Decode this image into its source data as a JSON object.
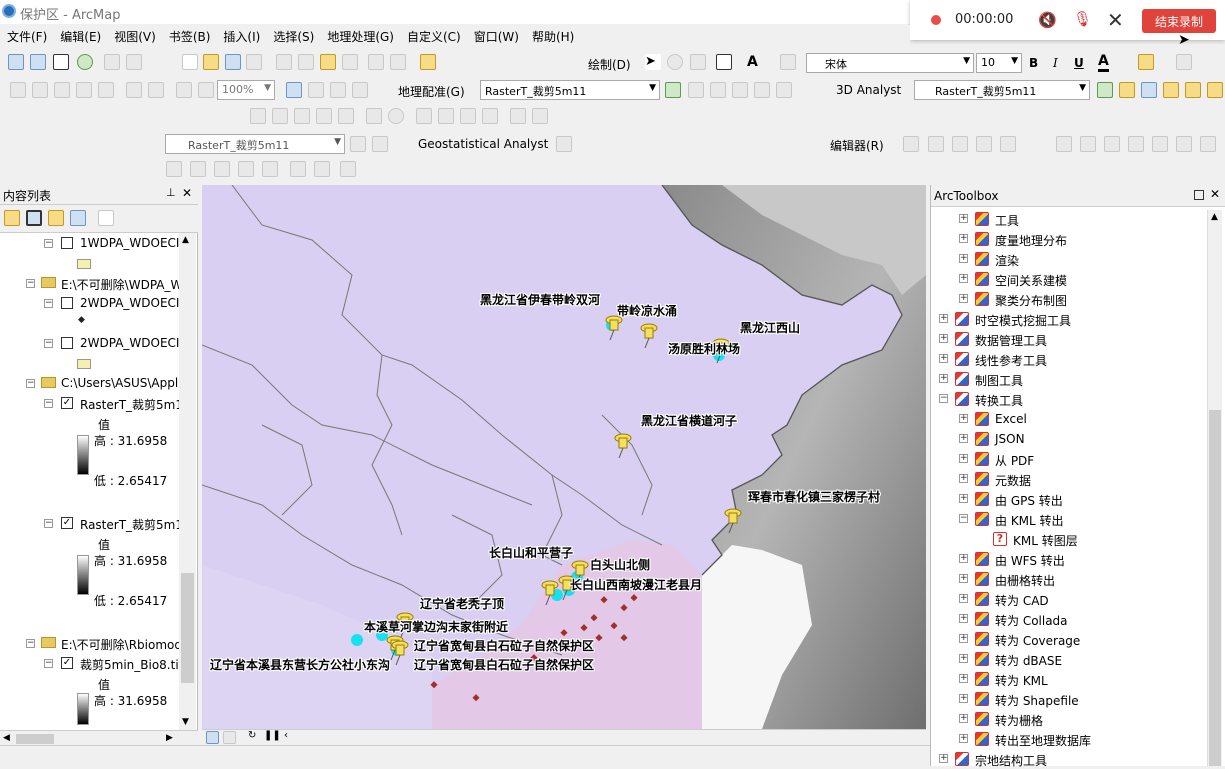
{
  "window": {
    "title": "保护区 - ArcMap"
  },
  "recorder": {
    "time": "00:00:00",
    "end_label": "结束录制"
  },
  "menu": [
    "文件(F)",
    "编辑(E)",
    "视图(V)",
    "书签(B)",
    "插入(I)",
    "选择(S)",
    "地理处理(G)",
    "自定义(C)",
    "窗口(W)",
    "帮助(H)"
  ],
  "toolbar": {
    "draw_label": "绘制(D)",
    "font_name": "宋体",
    "font_size": "10",
    "bold": "B",
    "italic": "I",
    "underline": "U",
    "zoom": "100%",
    "georef_label": "地理配准(G)",
    "georef_layer": "RasterT_裁剪5m11",
    "analyst3d_label": "3D Analyst",
    "analyst3d_layer": "RasterT_裁剪5m11",
    "geostat_layer": "RasterT_裁剪5m11",
    "geostat_label": "Geostatistical Analyst",
    "editor_label": "编辑器(R)"
  },
  "toc": {
    "title": "内容列表",
    "items": [
      {
        "type": "layer",
        "checked": false,
        "label": "1WDPA_WDOECI"
      },
      {
        "type": "group",
        "label": "E:\\不可删除\\WDPA_W"
      },
      {
        "type": "layer",
        "checked": false,
        "label": "2WDPA_WDOECI"
      },
      {
        "type": "layer",
        "checked": false,
        "label": "2WDPA_WDOECI"
      },
      {
        "type": "group",
        "label": "C:\\Users\\ASUS\\Appl"
      },
      {
        "type": "layer",
        "checked": true,
        "label": "RasterT_裁剪5m1"
      },
      {
        "type": "layer",
        "checked": true,
        "label": "RasterT_裁剪5m1"
      },
      {
        "type": "group",
        "label": "E:\\不可删除\\Rbiomod"
      },
      {
        "type": "layer",
        "checked": true,
        "label": "裁剪5min_Bio8.tif"
      }
    ],
    "legend": {
      "value": "值",
      "high": "高 : 31.6958",
      "low": "低 : 2.65417"
    }
  },
  "map": {
    "labels": [
      "黑龙江省伊春带岭双河",
      "带岭凉水涌",
      "黑龙江西山",
      "汤原胜利林场",
      "黑龙江省横道河子",
      "珲春市春化镇三家楞子村",
      "长白山和平营子",
      "白头山北侧",
      "长白山西南坡漫江老县月",
      "辽宁省老秃子顶",
      "本溪草河掌边沟末家街附近",
      "辽宁省宽甸县白石砬子自然保护区",
      "辽宁省本溪县东营长方公社小东沟",
      "辽宁省宽甸县白石砬子自然保护区"
    ]
  },
  "arctoolbox": {
    "title": "ArcToolbox",
    "items": [
      {
        "label": "工具",
        "level": 1
      },
      {
        "label": "度量地理分布",
        "level": 1
      },
      {
        "label": "渲染",
        "level": 1
      },
      {
        "label": "空间关系建模",
        "level": 1
      },
      {
        "label": "聚类分布制图",
        "level": 1
      },
      {
        "label": "时空模式挖掘工具",
        "level": 0
      },
      {
        "label": "数据管理工具",
        "level": 0
      },
      {
        "label": "线性参考工具",
        "level": 0
      },
      {
        "label": "制图工具",
        "level": 0
      },
      {
        "label": "转换工具",
        "level": 0
      },
      {
        "label": "Excel",
        "level": 1
      },
      {
        "label": "JSON",
        "level": 1
      },
      {
        "label": "从 PDF",
        "level": 1
      },
      {
        "label": "元数据",
        "level": 1
      },
      {
        "label": "由 GPS 转出",
        "level": 1
      },
      {
        "label": "由 KML 转出",
        "level": 1
      },
      {
        "label": "KML 转图层",
        "level": 2
      },
      {
        "label": "由 WFS 转出",
        "level": 1
      },
      {
        "label": "由栅格转出",
        "level": 1
      },
      {
        "label": "转为 CAD",
        "level": 1
      },
      {
        "label": "转为 Collada",
        "level": 1
      },
      {
        "label": "转为 Coverage",
        "level": 1
      },
      {
        "label": "转为 dBASE",
        "level": 1
      },
      {
        "label": "转为 KML",
        "level": 1
      },
      {
        "label": "转为 Shapefile",
        "level": 1
      },
      {
        "label": "转为栅格",
        "level": 1
      },
      {
        "label": "转出至地理数据库",
        "level": 1
      },
      {
        "label": "宗地结构工具",
        "level": 0
      }
    ]
  }
}
